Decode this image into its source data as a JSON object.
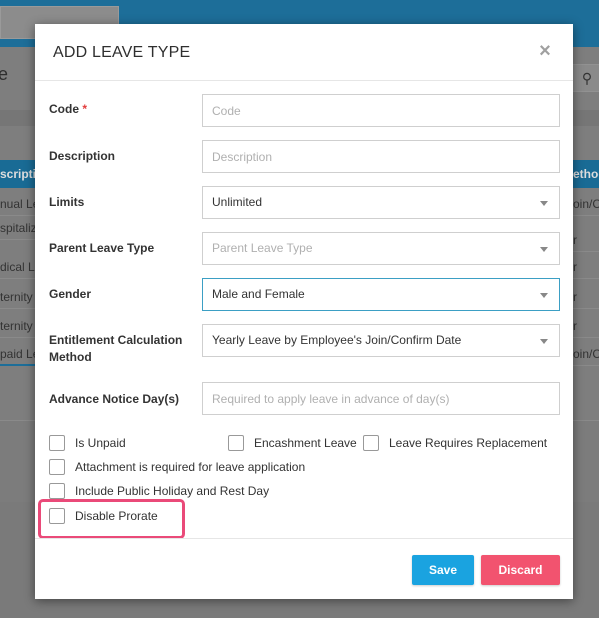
{
  "background": {
    "heading": "e",
    "table_header_left": "scriptio",
    "table_header_right": "ethod",
    "rows_left": [
      "nual Le",
      "spitaliz",
      "dical Le",
      "ternity",
      "ternity",
      "paid Le"
    ],
    "rows_right": [
      "oin/Co",
      "r",
      "r",
      "r",
      "r",
      "oin/Co"
    ]
  },
  "modal": {
    "title": "ADD LEAVE TYPE",
    "close_symbol": "×",
    "fields": {
      "code": {
        "label": "Code",
        "required_mark": "*",
        "placeholder": "Code",
        "value": ""
      },
      "description": {
        "label": "Description",
        "placeholder": "Description",
        "value": ""
      },
      "limits": {
        "label": "Limits",
        "value": "Unlimited"
      },
      "parent_leave_type": {
        "label": "Parent Leave Type",
        "value": "Parent Leave Type"
      },
      "gender": {
        "label": "Gender",
        "value": "Male and Female"
      },
      "entitlement_method": {
        "label_line1": "Entitlement Calculation",
        "label_line2": "Method",
        "value": "Yearly Leave by Employee's Join/Confirm Date"
      },
      "advance_notice": {
        "label": "Advance Notice Day(s)",
        "placeholder": "Required to apply leave in advance of day(s)",
        "value": ""
      }
    },
    "checkboxes": {
      "is_unpaid": {
        "label": "Is Unpaid",
        "checked": false
      },
      "encashment_leave": {
        "label": "Encashment Leave",
        "checked": false
      },
      "leave_requires_replacement": {
        "label": "Leave Requires Replacement",
        "checked": false
      },
      "attachment_required": {
        "label": "Attachment is required for leave application",
        "checked": false
      },
      "include_public_holiday": {
        "label": "Include Public Holiday and Rest Day",
        "checked": false
      },
      "disable_prorate": {
        "label": "Disable Prorate",
        "checked": false
      }
    },
    "buttons": {
      "save": "Save",
      "discard": "Discard"
    },
    "colors": {
      "save": "#1aa3e0",
      "discard": "#f2536f",
      "highlight": "#ea4a79",
      "required": "#e23c3c"
    }
  }
}
